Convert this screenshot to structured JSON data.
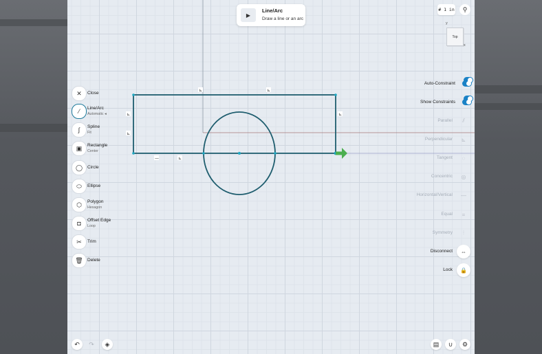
{
  "tooltip": {
    "title": "Line/Arc",
    "desc": "Draw a line or an arc"
  },
  "grid_badge": "# 1 in",
  "view_cube": {
    "face": "Top",
    "y_axis": "y",
    "x_axis": "x"
  },
  "tools": [
    {
      "label": "Close",
      "sub": "",
      "icon": "close-icon",
      "glyph": "✕"
    },
    {
      "label": "Line/Arc",
      "sub": "Automatic ◂",
      "icon": "line-arc-icon",
      "glyph": "⁄",
      "active": true
    },
    {
      "label": "Spline",
      "sub": "Fit",
      "icon": "spline-icon",
      "glyph": "∫"
    },
    {
      "label": "Rectangle",
      "sub": "Center",
      "icon": "rectangle-icon",
      "glyph": "▣"
    },
    {
      "label": "Circle",
      "sub": "",
      "icon": "circle-icon",
      "glyph": "◯"
    },
    {
      "label": "Ellipse",
      "sub": "",
      "icon": "ellipse-icon",
      "glyph": "⬭"
    },
    {
      "label": "Polygon",
      "sub": "Hexagon",
      "icon": "polygon-icon",
      "glyph": "⬡"
    },
    {
      "label": "Offset Edge",
      "sub": "Loop",
      "icon": "offset-edge-icon",
      "glyph": "◘"
    },
    {
      "label": "Trim",
      "sub": "",
      "icon": "trim-icon",
      "glyph": "✂"
    },
    {
      "label": "Delete",
      "sub": "",
      "icon": "delete-icon",
      "glyph": "🗑"
    }
  ],
  "constraints": [
    {
      "label": "Auto-Constraint",
      "kind": "toggle",
      "on": true
    },
    {
      "label": "Show Constraints",
      "kind": "toggle",
      "on": true
    },
    {
      "label": "Parallel",
      "kind": "dim",
      "glyph": "⫽"
    },
    {
      "label": "Perpendicular",
      "kind": "dim",
      "glyph": "⊾"
    },
    {
      "label": "Tangent",
      "kind": "dim",
      "glyph": "◌"
    },
    {
      "label": "Concentric",
      "kind": "dim",
      "glyph": "◎"
    },
    {
      "label": "Horizontal/Vertical",
      "kind": "dim",
      "glyph": "—"
    },
    {
      "label": "Equal",
      "kind": "dim",
      "glyph": "="
    },
    {
      "label": "Symmetry",
      "kind": "dim",
      "glyph": "⦙"
    },
    {
      "label": "Disconnect",
      "kind": "strong",
      "glyph": "⇔"
    },
    {
      "label": "Lock",
      "kind": "strong",
      "glyph": "🔒"
    }
  ],
  "colors": {
    "sketch": "#1e5d6e",
    "accent": "#1b82c6",
    "arrow": "#4caf50"
  }
}
